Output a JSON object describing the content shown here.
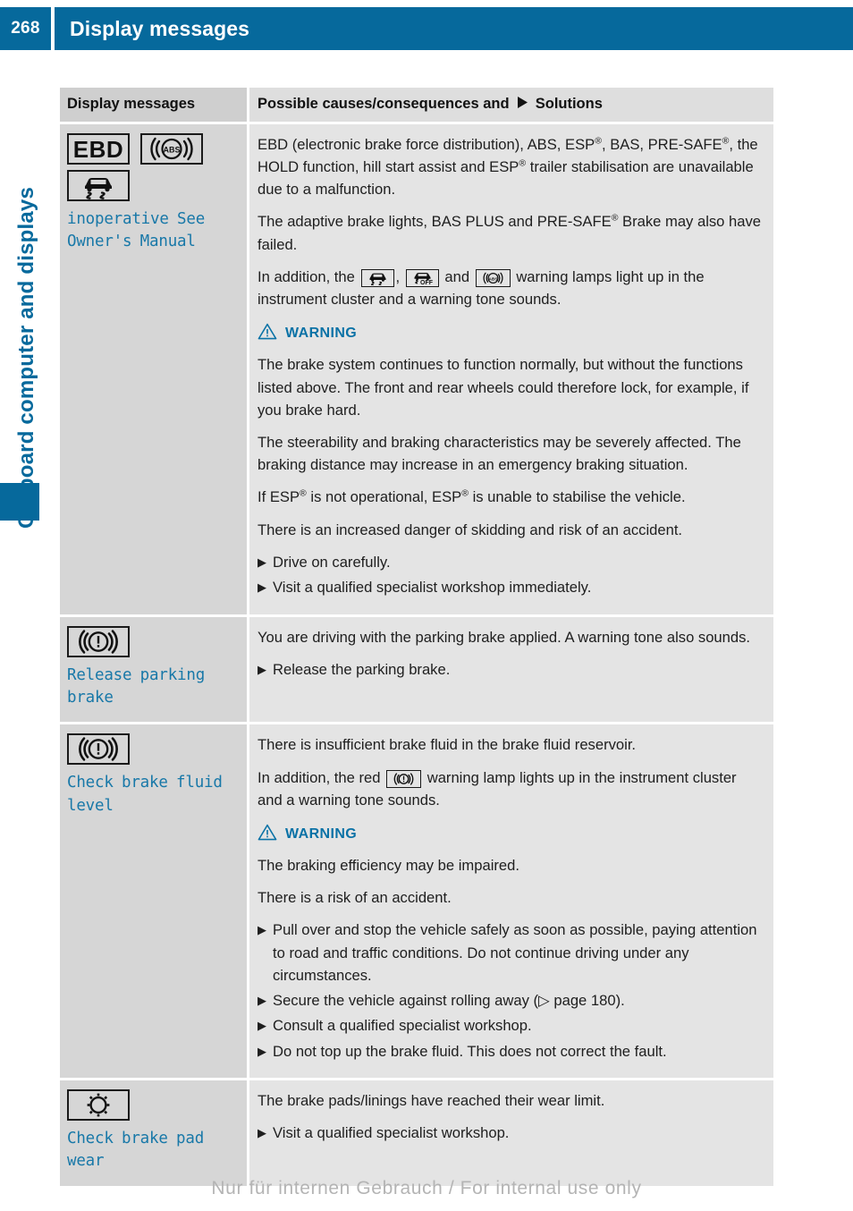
{
  "header": {
    "page_number": "268",
    "title": "Display messages"
  },
  "sidebar": {
    "chapter_label": "On-board computer and displays"
  },
  "table": {
    "columns": {
      "left": "Display messages",
      "right_prefix": "Possible causes/consequences and",
      "right_suffix": "Solutions"
    },
    "rows": [
      {
        "symbols": [
          "EBD",
          "abs-icon",
          "esp-skid-icon"
        ],
        "message": "inoperative See Owner's Manual",
        "blocks": [
          {
            "type": "p",
            "text": "EBD (electronic brake force distribution), ABS, ESP®, BAS, PRE-SAFE®, the HOLD function, hill start assist and ESP® trailer stabilisation are unavailable due to a malfunction."
          },
          {
            "type": "p",
            "text": "The adaptive brake lights, BAS PLUS and PRE-SAFE® Brake may also have failed."
          },
          {
            "type": "p-icons",
            "text": "In addition, the [esp-skid-icon], [esp-off-icon] and [abs-icon] warning lamps light up in the instrument cluster and a warning tone sounds."
          },
          {
            "type": "warning",
            "text": "WARNING"
          },
          {
            "type": "p",
            "text": "The brake system continues to function normally, but without the functions listed above. The front and rear wheels could therefore lock, for example, if you brake hard."
          },
          {
            "type": "p",
            "text": "The steerability and braking characteristics may be severely affected. The braking distance may increase in an emergency braking situation."
          },
          {
            "type": "p",
            "text": "If ESP® is not operational, ESP® is unable to stabilise the vehicle."
          },
          {
            "type": "p",
            "text": "There is an increased danger of skidding and risk of an accident."
          },
          {
            "type": "bullet",
            "text": "Drive on carefully."
          },
          {
            "type": "bullet",
            "text": "Visit a qualified specialist workshop immediately."
          }
        ]
      },
      {
        "symbols": [
          "brake-warning-icon"
        ],
        "message": "Release parking brake",
        "blocks": [
          {
            "type": "p",
            "text": "You are driving with the parking brake applied. A warning tone also sounds."
          },
          {
            "type": "bullet",
            "text": "Release the parking brake."
          }
        ]
      },
      {
        "symbols": [
          "brake-warning-icon"
        ],
        "message": "Check brake fluid level",
        "blocks": [
          {
            "type": "p",
            "text": "There is insufficient brake fluid in the brake fluid reservoir."
          },
          {
            "type": "p-icons",
            "text": "In addition, the red [brake-warning-icon] warning lamp lights up in the instrument cluster and a warning tone sounds."
          },
          {
            "type": "warning",
            "text": "WARNING"
          },
          {
            "type": "p",
            "text": "The braking efficiency may be impaired."
          },
          {
            "type": "p",
            "text": "There is a risk of an accident."
          },
          {
            "type": "bullet",
            "text": "Pull over and stop the vehicle safely as soon as possible, paying attention to road and traffic conditions. Do not continue driving under any circumstances."
          },
          {
            "type": "bullet",
            "text": "Secure the vehicle against rolling away (▷ page 180)."
          },
          {
            "type": "bullet",
            "text": "Consult a qualified specialist workshop."
          },
          {
            "type": "bullet",
            "text": "Do not top up the brake fluid. This does not correct the fault."
          }
        ]
      },
      {
        "symbols": [
          "brake-pad-wear-icon"
        ],
        "message": "Check brake pad wear",
        "blocks": [
          {
            "type": "p",
            "text": "The brake pads/linings have reached their wear limit."
          },
          {
            "type": "bullet",
            "text": "Visit a qualified specialist workshop."
          }
        ]
      }
    ]
  },
  "footer": {
    "watermark": "Nur für internen Gebrauch / For internal use only"
  },
  "colors": {
    "brand_blue": "#06699c",
    "message_blue": "#1878a8",
    "warning_blue": "#0a72a6",
    "left_cell_bg": "#d6d6d6",
    "right_cell_bg": "#e4e4e4"
  },
  "row1_text": {
    "p1_a": "EBD (electronic brake force distribution), ABS, ESP",
    "p1_b": ", BAS, PRE-SAFE",
    "p1_c": ", the HOLD function, hill start assist and ESP",
    "p1_d": " trailer stabilisation are unavailable due to a malfunction.",
    "p2_a": "The adaptive brake lights, BAS PLUS and PRE-SAFE",
    "p2_b": " Brake may also have failed.",
    "p3_a": "In addition, the",
    "p3_b": ",",
    "p3_c": "and",
    "p3_d": "warning lamps light up in the instrument cluster and a warning tone sounds.",
    "warning_label": "WARNING",
    "p4": "The brake system continues to function normally, but without the functions listed above. The front and rear wheels could therefore lock, for example, if you brake hard.",
    "p5": "The steerability and braking characteristics may be severely affected. The braking distance may increase in an emergency braking situation.",
    "p6_a": "If ESP",
    "p6_b": " is not operational, ESP",
    "p6_c": " is unable to stabilise the vehicle.",
    "p7": "There is an increased danger of skidding and risk of an accident.",
    "b1": "Drive on carefully.",
    "b2": "Visit a qualified specialist workshop immediately.",
    "msg_line1": "inoperative See",
    "msg_line2": "Owner's Manual",
    "ebd_label": "EBD"
  },
  "row2_text": {
    "p1": "You are driving with the parking brake applied. A warning tone also sounds.",
    "b1": "Release the parking brake.",
    "msg_line1": "Release parking",
    "msg_line2": "brake"
  },
  "row3_text": {
    "p1": "There is insufficient brake fluid in the brake fluid reservoir.",
    "p2_a": "In addition, the red",
    "p2_b": "warning lamp lights up in the instrument cluster and a warning tone sounds.",
    "warning_label": "WARNING",
    "p3": "The braking efficiency may be impaired.",
    "p4": "There is a risk of an accident.",
    "b1": "Pull over and stop the vehicle safely as soon as possible, paying attention to road and traffic conditions. Do not continue driving under any circumstances.",
    "b2": "Secure the vehicle against rolling away (▷ page 180).",
    "b3": "Consult a qualified specialist workshop.",
    "b4": "Do not top up the brake fluid. This does not correct the fault.",
    "msg_line1": "Check brake fluid",
    "msg_line2": "level"
  },
  "row4_text": {
    "p1": "The brake pads/linings have reached their wear limit.",
    "b1": "Visit a qualified specialist workshop.",
    "msg_line1": "Check brake pad",
    "msg_line2": "wear"
  },
  "glyphs": {
    "bullet_marker": "▶",
    "header_marker": "▶"
  }
}
